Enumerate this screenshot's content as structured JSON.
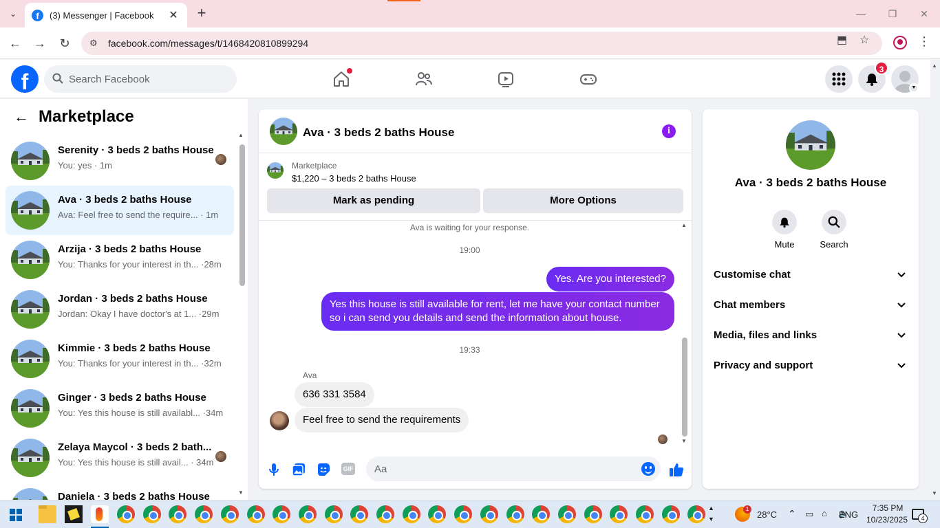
{
  "browser": {
    "tab_title": "(3) Messenger | Facebook",
    "url": "facebook.com/messages/t/1468420810899294"
  },
  "header": {
    "search_placeholder": "Search Facebook",
    "notification_count": "3"
  },
  "sidebar": {
    "title": "Marketplace",
    "conversations": [
      {
        "name": "Serenity · 3 beds 2 baths House",
        "preview": "You: yes · 1m",
        "active": false,
        "seen_avatar": true
      },
      {
        "name": "Ava · 3 beds 2 baths House",
        "preview": "Ava: Feel free to send the require... · 1m",
        "active": true,
        "seen_avatar": false
      },
      {
        "name": "Arzija · 3 beds 2 baths House",
        "preview": "You: Thanks for your interest in th... ·28m",
        "active": false,
        "seen_avatar": false
      },
      {
        "name": "Jordan · 3 beds 2 baths House",
        "preview": "Jordan: Okay I have doctor's at 1... ·29m",
        "active": false,
        "seen_avatar": false
      },
      {
        "name": "Kimmie · 3 beds 2 baths House",
        "preview": "You: Thanks for your interest in th... ·32m",
        "active": false,
        "seen_avatar": false
      },
      {
        "name": "Ginger · 3 beds 2 baths House",
        "preview": "You: Yes this house is still availabl... ·34m",
        "active": false,
        "seen_avatar": false
      },
      {
        "name": "Zelaya Maycol · 3 beds 2 bath...",
        "preview": "You: Yes this house is still avail... · 34m",
        "active": false,
        "seen_avatar": true
      },
      {
        "name": "Daniela · 3 beds 2 baths House",
        "preview": "",
        "active": false,
        "seen_avatar": false
      }
    ]
  },
  "chat": {
    "title": "Ava · 3 beds 2 baths House",
    "marketplace_label": "Marketplace",
    "listing": "$1,220 – 3 beds 2 baths House",
    "mark_pending": "Mark as pending",
    "more_options": "More Options",
    "waiting_notice": "Ava is waiting for your response.",
    "time_1": "19:00",
    "out_msg_1": "Yes. Are you interested?",
    "out_msg_2": "Yes this house is still available for rent, let me have your contact number so i can send you details and send the information about house.",
    "time_2": "19:33",
    "sender": "Ava",
    "in_msg_1": "636 331 3584",
    "in_msg_2": "Feel free to send the requirements",
    "composer_placeholder": "Aa"
  },
  "info": {
    "name": "Ava · 3 beds 2 baths House",
    "mute": "Mute",
    "search": "Search",
    "sections": [
      "Customise chat",
      "Chat members",
      "Media, files and links",
      "Privacy and support"
    ]
  },
  "taskbar": {
    "temperature": "28°C",
    "language": "ENG",
    "time": "7:35 PM",
    "date": "10/23/2025",
    "weather_alert": "1",
    "notifications": "4"
  },
  "colors": {
    "brand": "#0866ff",
    "bubble_out": "#7b2ff7",
    "active_row": "#e7f3ff",
    "badge": "#e41e3f"
  }
}
